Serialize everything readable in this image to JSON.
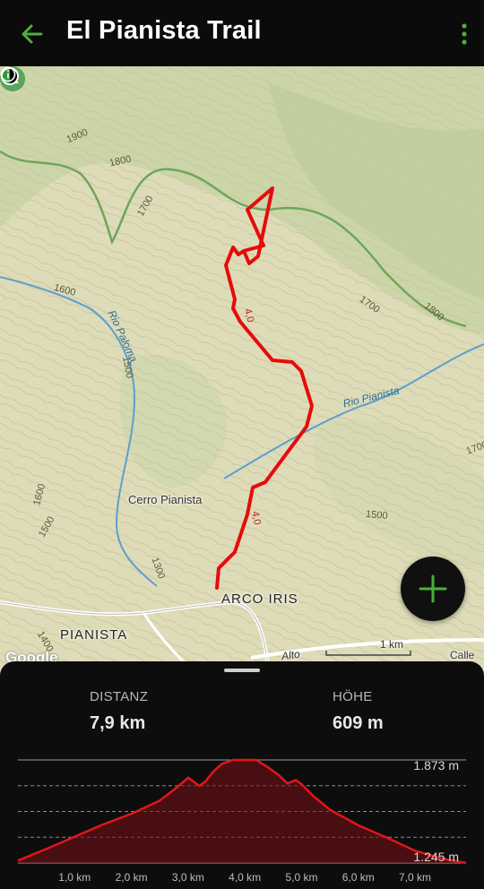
{
  "header": {
    "title": "El Pianista Trail"
  },
  "map": {
    "contour_labels": [
      "1900",
      "1800",
      "1700",
      "1600",
      "1500",
      "1600",
      "1500",
      "1300",
      "1400",
      "1700",
      "1800",
      "1500",
      "1700"
    ],
    "rivers": [
      "Rio Paloma",
      "Rio Pianista"
    ],
    "route_km_markers": [
      "4,0",
      "4,0"
    ],
    "poi": "Cerro Pianista",
    "places": [
      "ARCO IRIS",
      "PIANISTA"
    ],
    "roads": [
      "Alto",
      "Calle"
    ],
    "scale_label": "1 km",
    "attribution": "Google",
    "colors": {
      "route": "#e60b0b",
      "topo_base": "#dedbb8",
      "river": "#5b9fd0",
      "fab_plus": "#4caf39"
    }
  },
  "sheet": {
    "distance_label": "DISTANZ",
    "distance_value": "7,9 km",
    "height_label": "HÖHE",
    "height_value": "609 m"
  },
  "chart_data": {
    "type": "area",
    "title": "",
    "xlabel": "",
    "ylabel": "",
    "x_ticks": [
      "1,0 km",
      "2,0 km",
      "3,0 km",
      "4,0 km",
      "5,0 km",
      "6,0 km",
      "7,0 km"
    ],
    "y_max_label": "1.873 m",
    "y_min_label": "1.245 m",
    "ylim": [
      1245,
      1873
    ],
    "xlim": [
      0,
      7.9
    ],
    "grid": true,
    "series": [
      {
        "x": [
          0,
          0.5,
          1.0,
          1.5,
          2.0,
          2.5,
          2.8,
          3.0,
          3.2,
          3.3,
          3.45,
          3.6,
          3.8,
          4.0,
          4.2,
          4.4,
          4.6,
          4.75,
          4.9,
          5.0,
          5.2,
          5.5,
          6.0,
          6.5,
          7.0,
          7.5,
          7.9
        ],
        "y": [
          1260,
          1330,
          1405,
          1480,
          1545,
          1625,
          1705,
          1765,
          1715,
          1740,
          1805,
          1850,
          1873,
          1873,
          1873,
          1830,
          1780,
          1730,
          1750,
          1725,
          1655,
          1570,
          1475,
          1400,
          1320,
          1270,
          1245
        ]
      }
    ],
    "colors": {
      "line": "#e0161b",
      "fill": "#7a1015"
    }
  }
}
